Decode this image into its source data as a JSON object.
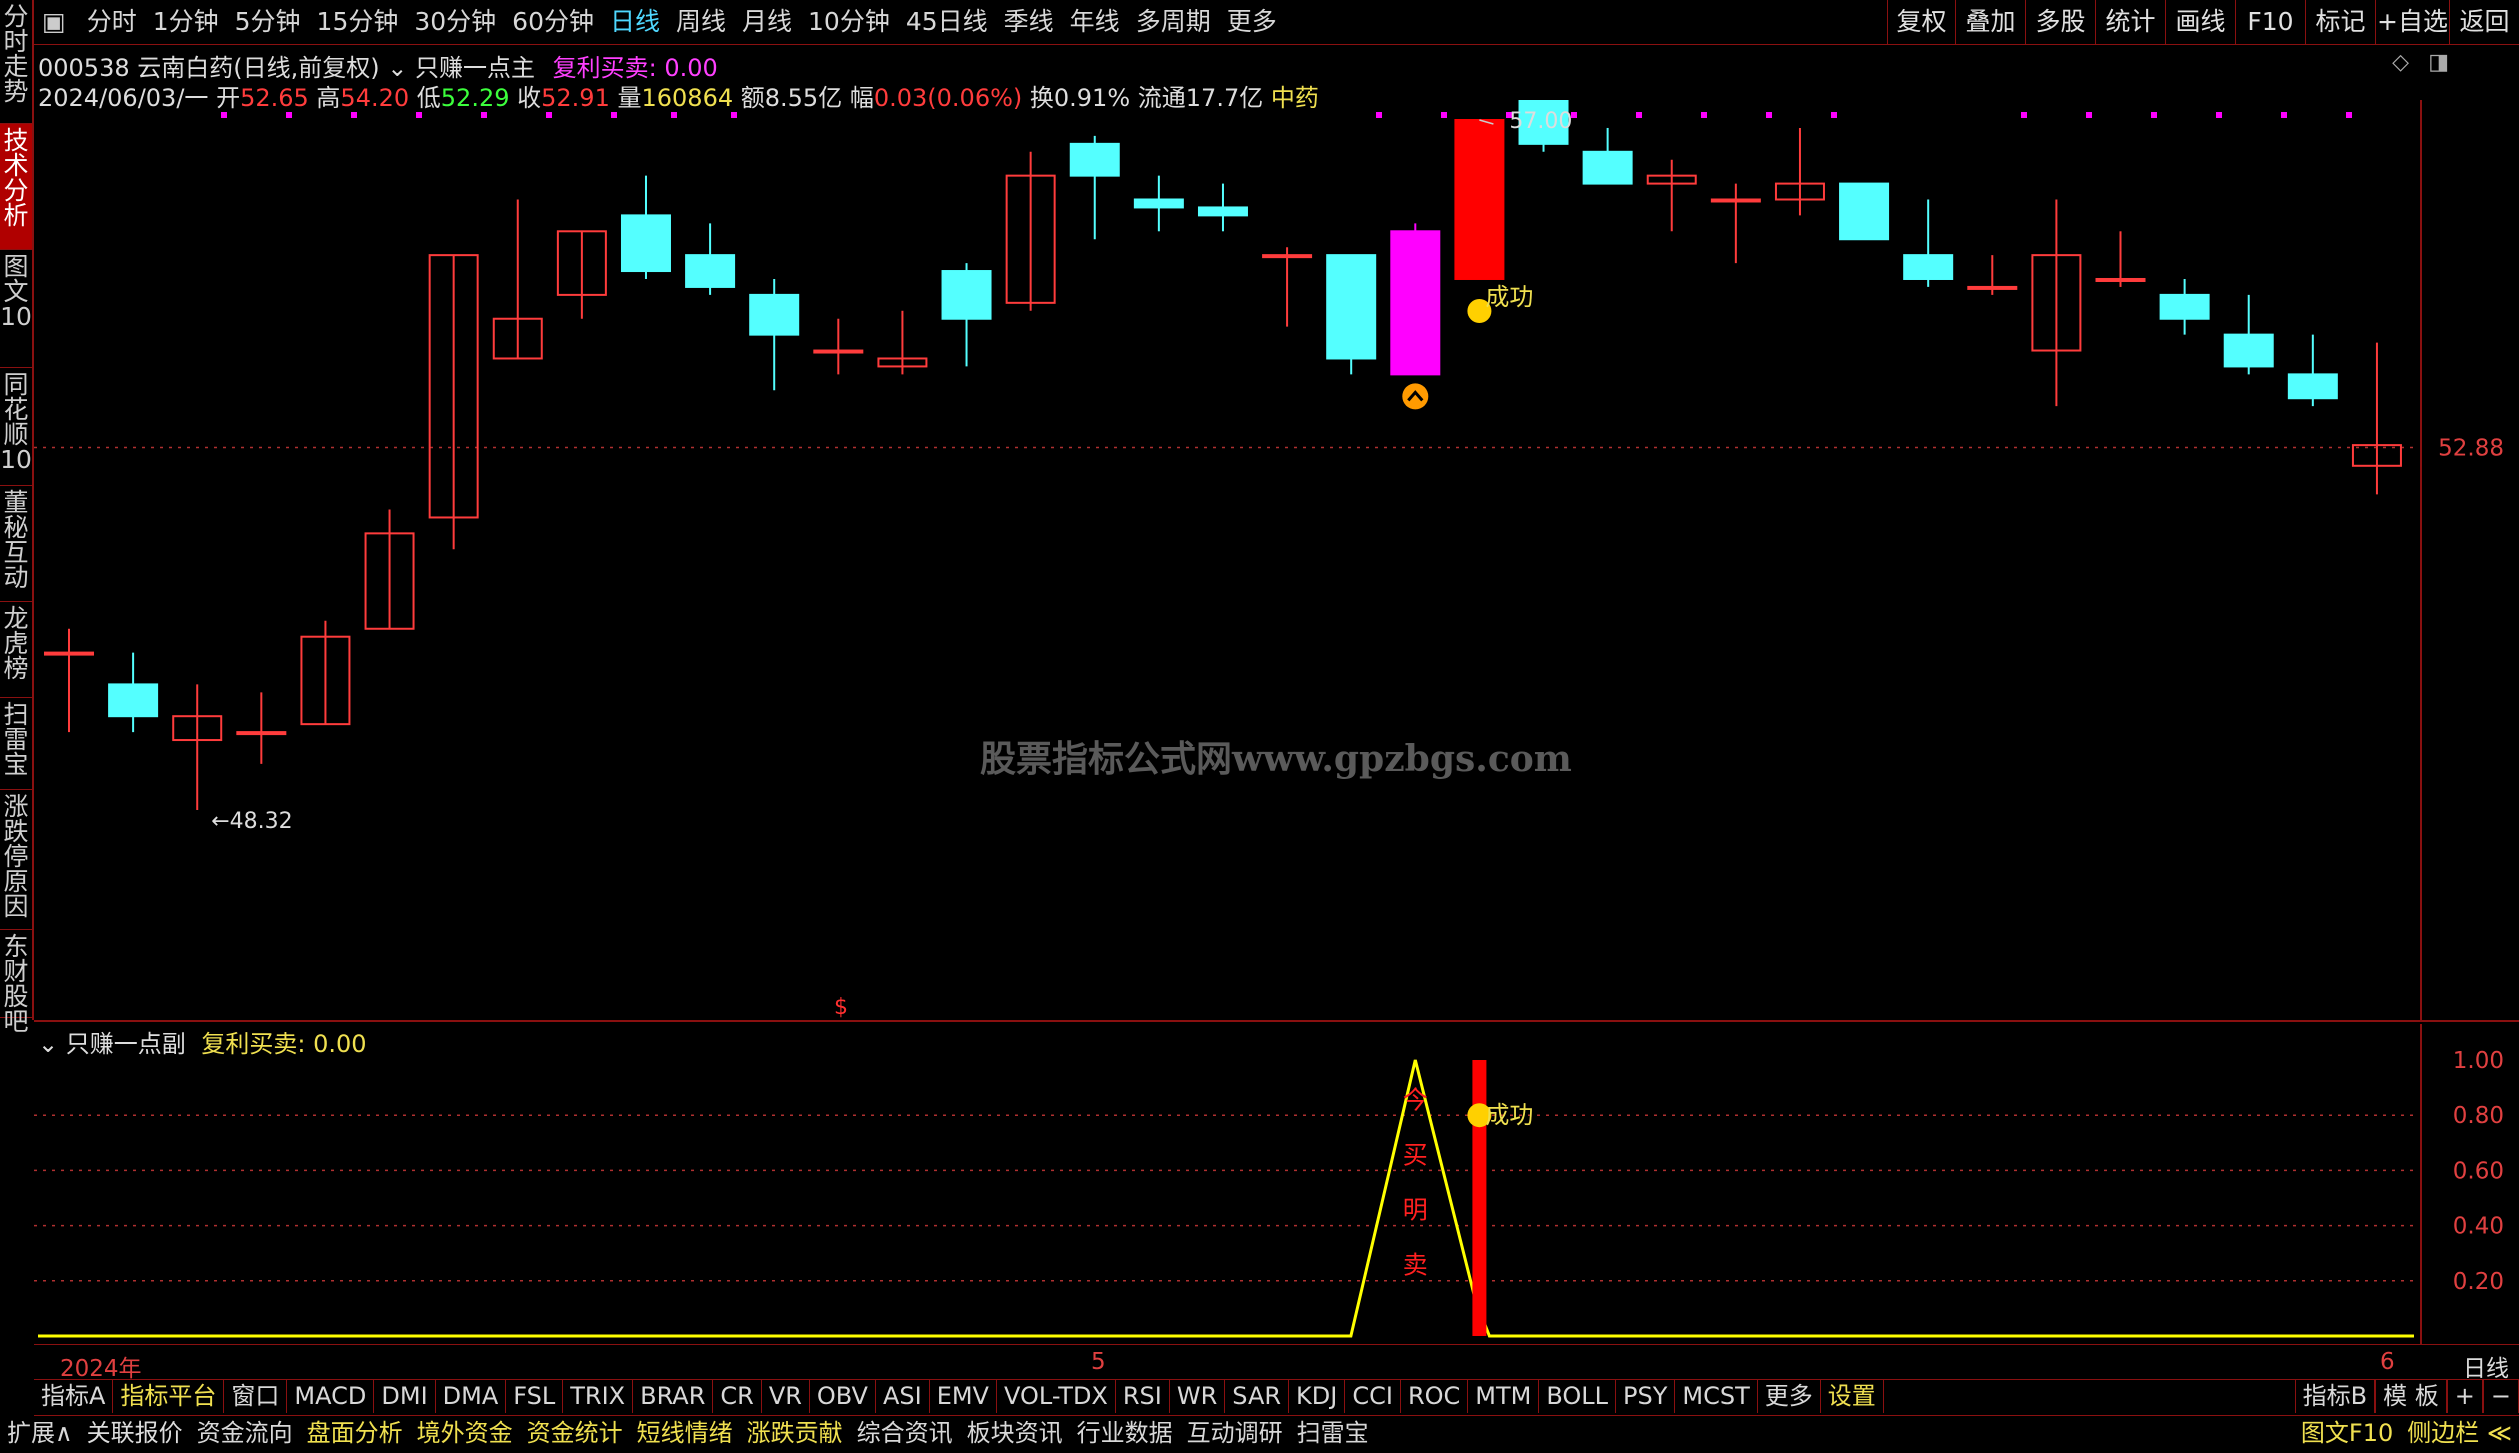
{
  "toolbar": {
    "periods": [
      "分时",
      "1分钟",
      "5分钟",
      "15分钟",
      "30分钟",
      "60分钟",
      "日线",
      "周线",
      "月线",
      "10分钟",
      "45日线",
      "季线",
      "年线",
      "多周期",
      "更多"
    ],
    "active_period": "日线",
    "right_buttons": [
      "复权",
      "叠加",
      "多股",
      "统计",
      "画线",
      "F10",
      "标记",
      "+自选",
      "返回"
    ]
  },
  "sidebar": {
    "items": [
      "分时走势",
      "技术分析",
      "图文10",
      "同花顺10",
      "董秘互动",
      "龙虎榜",
      "扫雷宝",
      "涨跌停原因",
      "东财股吧"
    ],
    "active": "技术分析"
  },
  "header": {
    "code_name": "000538 云南白药(日线,前复权)",
    "main_indicator": "只赚一点主",
    "signal_label": "复利买卖: 0.00"
  },
  "quote": {
    "date": "2024/06/03/一",
    "open_label": "开",
    "open": "52.65",
    "high_label": "高",
    "high": "54.20",
    "low_label": "低",
    "low": "52.29",
    "close_label": "收",
    "close": "52.91",
    "vol_label": "量",
    "vol": "160864",
    "amt_label": "额",
    "amt": "8.55亿",
    "chg_label": "幅",
    "chg": "0.03(0.06%)",
    "turn": "换0.91%",
    "float": "流通17.7亿",
    "sector": "中药"
  },
  "main_chart": {
    "price_marker": "52.88",
    "high_annot": "57.00",
    "low_annot": "48.32",
    "success_label": "成功",
    "watermark": "股票指标公式网www.gpzbgs.com",
    "dollar_mark": "$"
  },
  "sub_chart": {
    "indicator": "只赚一点副",
    "signal_label": "复利买卖: 0.00",
    "y_ticks": [
      "1.00",
      "0.80",
      "0.60",
      "0.40",
      "0.20"
    ],
    "success_label": "成功",
    "vertical_text": [
      "今",
      "买",
      "明",
      "卖"
    ]
  },
  "x_axis": {
    "labels": [
      "2024年",
      "5",
      "6"
    ],
    "period_label": "日线"
  },
  "indicator_tabs": {
    "items": [
      "指标A",
      "指标平台",
      "窗口",
      "MACD",
      "DMI",
      "DMA",
      "FSL",
      "TRIX",
      "BRAR",
      "CR",
      "VR",
      "OBV",
      "ASI",
      "EMV",
      "VOL-TDX",
      "RSI",
      "WR",
      "SAR",
      "KDJ",
      "CCI",
      "ROC",
      "MTM",
      "BOLL",
      "PSY",
      "MCST",
      "更多",
      "设置"
    ],
    "right": [
      "指标B",
      "模 板",
      "+",
      "−"
    ]
  },
  "status_bar": {
    "items": [
      "扩展∧",
      "关联报价",
      "资金流向",
      "盘面分析",
      "境外资金",
      "资金统计",
      "短线情绪",
      "涨跌贡献",
      "综合资讯",
      "板块资讯",
      "行业数据",
      "互动调研",
      "扫雷宝"
    ],
    "right": [
      "图文F10",
      "侧边栏 ≪"
    ]
  },
  "chart_data": {
    "type": "candlestick",
    "series": [
      {
        "o": 50.3,
        "h": 50.6,
        "l": 49.3,
        "c": 50.3
      },
      {
        "o": 49.9,
        "h": 50.3,
        "l": 49.3,
        "c": 49.5
      },
      {
        "o": 49.2,
        "h": 49.9,
        "l": 48.32,
        "c": 49.5
      },
      {
        "o": 49.3,
        "h": 49.8,
        "l": 48.9,
        "c": 49.3
      },
      {
        "o": 49.4,
        "h": 50.7,
        "l": 49.4,
        "c": 50.5
      },
      {
        "o": 50.6,
        "h": 52.1,
        "l": 50.6,
        "c": 51.8
      },
      {
        "o": 52.0,
        "h": 55.3,
        "l": 51.6,
        "c": 55.3
      },
      {
        "o": 54.0,
        "h": 56.0,
        "l": 54.0,
        "c": 54.5
      },
      {
        "o": 54.8,
        "h": 55.6,
        "l": 54.5,
        "c": 55.6
      },
      {
        "o": 55.8,
        "h": 56.3,
        "l": 55.0,
        "c": 55.1
      },
      {
        "o": 55.3,
        "h": 55.7,
        "l": 54.8,
        "c": 54.9
      },
      {
        "o": 54.8,
        "h": 55.0,
        "l": 53.6,
        "c": 54.3
      },
      {
        "o": 54.1,
        "h": 54.5,
        "l": 53.8,
        "c": 54.1
      },
      {
        "o": 53.9,
        "h": 54.6,
        "l": 53.8,
        "c": 54.0
      },
      {
        "o": 55.1,
        "h": 55.2,
        "l": 53.9,
        "c": 54.5
      },
      {
        "o": 54.7,
        "h": 56.6,
        "l": 54.6,
        "c": 56.3
      },
      {
        "o": 56.7,
        "h": 56.8,
        "l": 55.5,
        "c": 56.3
      },
      {
        "o": 56.0,
        "h": 56.3,
        "l": 55.6,
        "c": 55.9
      },
      {
        "o": 55.9,
        "h": 56.2,
        "l": 55.6,
        "c": 55.8
      },
      {
        "o": 55.3,
        "h": 55.4,
        "l": 54.4,
        "c": 55.3
      },
      {
        "o": 55.3,
        "h": 55.3,
        "l": 53.8,
        "c": 54.0
      },
      {
        "o": 55.6,
        "h": 55.7,
        "l": 53.8,
        "c": 53.8
      },
      {
        "o": 55.0,
        "h": 57.0,
        "l": 55.0,
        "c": 57.0
      },
      {
        "o": 57.3,
        "h": 57.6,
        "l": 56.6,
        "c": 56.7
      },
      {
        "o": 56.6,
        "h": 56.9,
        "l": 56.2,
        "c": 56.2
      },
      {
        "o": 56.2,
        "h": 56.5,
        "l": 55.6,
        "c": 56.3
      },
      {
        "o": 56.0,
        "h": 56.2,
        "l": 55.2,
        "c": 56.0
      },
      {
        "o": 56.0,
        "h": 56.9,
        "l": 55.8,
        "c": 56.2
      },
      {
        "o": 56.2,
        "h": 56.2,
        "l": 55.5,
        "c": 55.5
      },
      {
        "o": 55.3,
        "h": 56.0,
        "l": 54.9,
        "c": 55.0
      },
      {
        "o": 54.9,
        "h": 55.3,
        "l": 54.8,
        "c": 54.9
      },
      {
        "o": 54.1,
        "h": 56.0,
        "l": 53.4,
        "c": 55.3
      },
      {
        "o": 55.0,
        "h": 55.6,
        "l": 54.9,
        "c": 55.0
      },
      {
        "o": 54.8,
        "h": 55.0,
        "l": 54.3,
        "c": 54.5
      },
      {
        "o": 54.3,
        "h": 54.8,
        "l": 53.8,
        "c": 53.9
      },
      {
        "o": 53.8,
        "h": 54.3,
        "l": 53.4,
        "c": 53.5
      },
      {
        "o": 52.65,
        "h": 54.2,
        "l": 52.29,
        "c": 52.91
      }
    ],
    "colors": {
      "up": "#ff3c3c",
      "down": "#54ffff",
      "limit_up_bar": "#ff0000",
      "signal_bar": "#ff00ff"
    },
    "special": {
      "signal_index": 21,
      "limit_up_index": 22
    },
    "sub_series": {
      "line_peak_index": 21,
      "bar_index": 22,
      "line_color": "#ffff00",
      "bar_color": "#ff0000"
    }
  }
}
